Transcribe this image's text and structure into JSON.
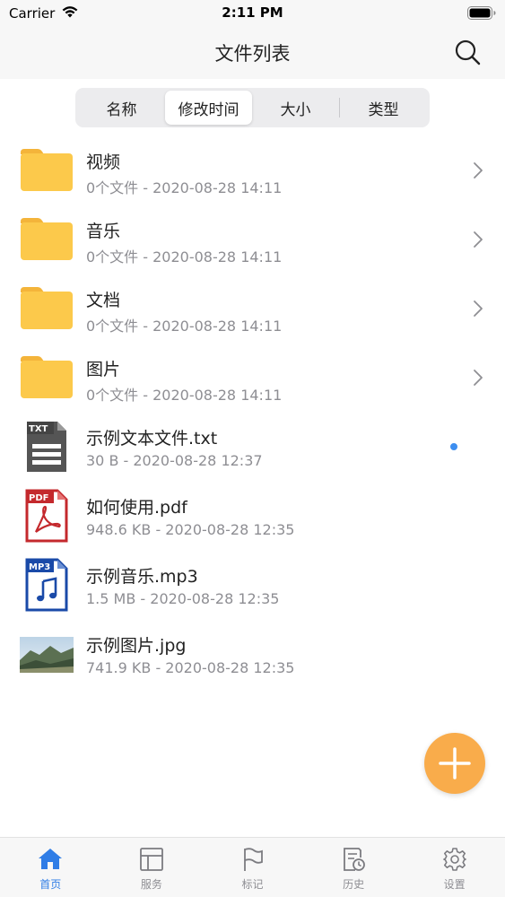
{
  "status_bar": {
    "carrier": "Carrier",
    "time": "2:11 PM"
  },
  "nav": {
    "title": "文件列表"
  },
  "sort_segments": [
    {
      "label": "名称",
      "active": false
    },
    {
      "label": "修改时间",
      "active": true
    },
    {
      "label": "大小",
      "active": false
    },
    {
      "label": "类型",
      "active": false
    }
  ],
  "files": [
    {
      "name": "视频",
      "meta": "0个文件 - 2020-08-28 14:11",
      "type": "folder"
    },
    {
      "name": "音乐",
      "meta": "0个文件 - 2020-08-28 14:11",
      "type": "folder"
    },
    {
      "name": "文档",
      "meta": "0个文件 - 2020-08-28 14:11",
      "type": "folder"
    },
    {
      "name": "图片",
      "meta": "0个文件 - 2020-08-28 14:11",
      "type": "folder"
    },
    {
      "name": "示例文本文件.txt",
      "meta": "30 B - 2020-08-28 12:37",
      "type": "txt",
      "badge": "TXT",
      "new": true
    },
    {
      "name": "如何使用.pdf",
      "meta": "948.6 KB - 2020-08-28 12:35",
      "type": "pdf",
      "badge": "PDF"
    },
    {
      "name": "示例音乐.mp3",
      "meta": "1.5 MB - 2020-08-28 12:35",
      "type": "mp3",
      "badge": "MP3"
    },
    {
      "name": "示例图片.jpg",
      "meta": "741.9 KB - 2020-08-28 12:35",
      "type": "jpg"
    }
  ],
  "tabs": [
    {
      "label": "首页",
      "icon": "home-icon",
      "active": true
    },
    {
      "label": "服务",
      "icon": "layout-icon",
      "active": false
    },
    {
      "label": "标记",
      "icon": "flag-icon",
      "active": false
    },
    {
      "label": "历史",
      "icon": "history-icon",
      "active": false
    },
    {
      "label": "设置",
      "icon": "gear-icon",
      "active": false
    }
  ],
  "colors": {
    "accent": "#2f7de6",
    "folder": "#fcc94b",
    "fab": "#f9ac4b",
    "pdf": "#c4292d",
    "mp3": "#1a4aa8",
    "txt": "#555555",
    "new_dot": "#3d8ef0"
  }
}
